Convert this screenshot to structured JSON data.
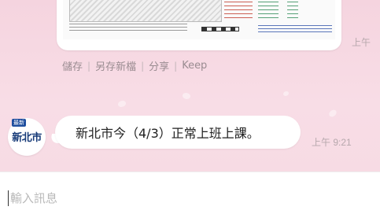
{
  "chat": {
    "image_message": {
      "time": "上午"
    },
    "image_actions": [
      {
        "label": "儲存"
      },
      {
        "label": "另存新檔"
      },
      {
        "label": "分享"
      },
      {
        "label": "Keep"
      }
    ],
    "sender": {
      "badge": "最新",
      "avatar_text": "新北市"
    },
    "text_message": {
      "text": "新北市今（4/3）正常上班上課。",
      "time": "上午 9:21"
    }
  },
  "composer": {
    "placeholder": "輸入訊息"
  },
  "colors": {
    "chat_background": "#f6dbe4",
    "bubble": "#ffffff",
    "timestamp": "#b7a8ad",
    "avatar_text": "#163a78",
    "badge": "#1f4e9e"
  }
}
